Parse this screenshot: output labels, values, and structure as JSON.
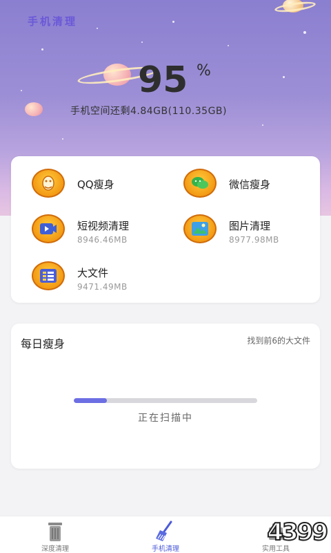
{
  "header": {
    "app_title": "手机清理",
    "percent": "95",
    "percent_sign": "%",
    "storage_text": "手机空间还剩4.84GB(110.35GB)"
  },
  "tools": [
    {
      "name": "QQ瘦身",
      "size": "",
      "icon": "qq-penguin-icon"
    },
    {
      "name": "微信瘦身",
      "size": "",
      "icon": "wechat-icon"
    },
    {
      "name": "短视频清理",
      "size": "8946.46MB",
      "icon": "video-icon"
    },
    {
      "name": "图片清理",
      "size": "8977.98MB",
      "icon": "image-icon"
    },
    {
      "name": "大文件",
      "size": "9471.49MB",
      "icon": "file-icon"
    }
  ],
  "daily": {
    "title": "每日瘦身",
    "hint": "找到前6的大文件",
    "progress": 0.18,
    "status": "正在扫描中"
  },
  "tabbar": {
    "items": [
      {
        "label": "深度清理",
        "icon": "trash-bin-icon",
        "active": false
      },
      {
        "label": "手机清理",
        "icon": "broom-icon",
        "active": true
      },
      {
        "label": "实用工具",
        "icon": "toolbox-icon",
        "active": false
      }
    ]
  },
  "watermark": "4399",
  "colors": {
    "accent": "#6c6ee3",
    "tab_active": "#4c5bd8",
    "icon_orange": "#f39a14"
  }
}
